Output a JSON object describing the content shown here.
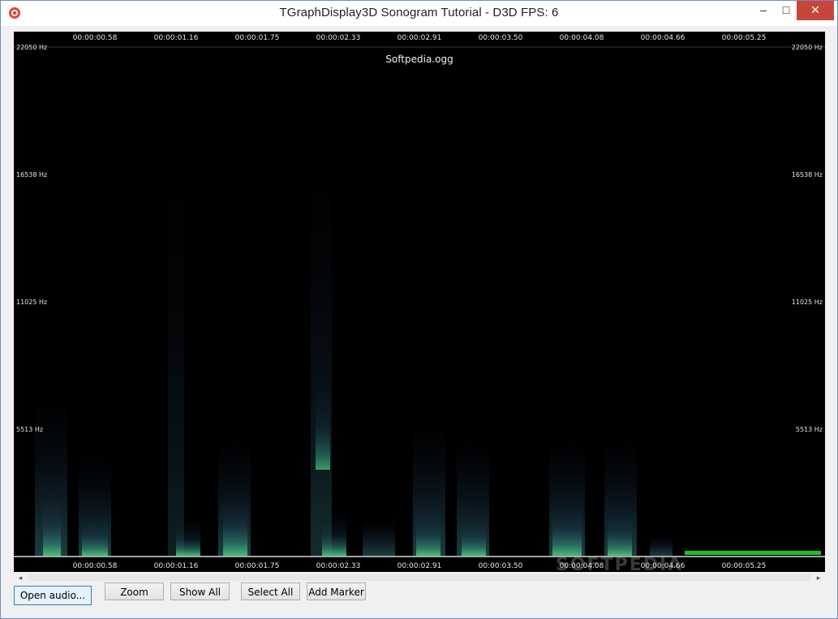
{
  "window": {
    "title": "TGraphDisplay3D Sonogram Tutorial - D3D FPS: 6",
    "minimize_glyph": "–",
    "maximize_glyph": "□",
    "close_glyph": "✕"
  },
  "sonogram": {
    "file_name": "Softpedia.ogg",
    "time_labels": [
      "00:00:00.58",
      "00:00:01.16",
      "00:00:01.75",
      "00:00:02.33",
      "00:00:02.91",
      "00:00:03.50",
      "00:00:04.08",
      "00:00:04.66",
      "00:00:05.25"
    ],
    "freq_labels": [
      "22050 Hz",
      "16538 Hz",
      "11025 Hz",
      "5513 Hz"
    ],
    "colors": {
      "background": "#000000",
      "energy": "#3fae6a",
      "cursor": "#1fbf2a"
    }
  },
  "scrollbar": {
    "left_glyph": "◂",
    "right_glyph": "▸"
  },
  "buttons": {
    "open_audio": "Open audio...",
    "zoom": "Zoom",
    "show_all": "Show All",
    "select_all": "Select All",
    "add_marker": "Add Marker"
  },
  "watermark": "SOFTPEDIA"
}
